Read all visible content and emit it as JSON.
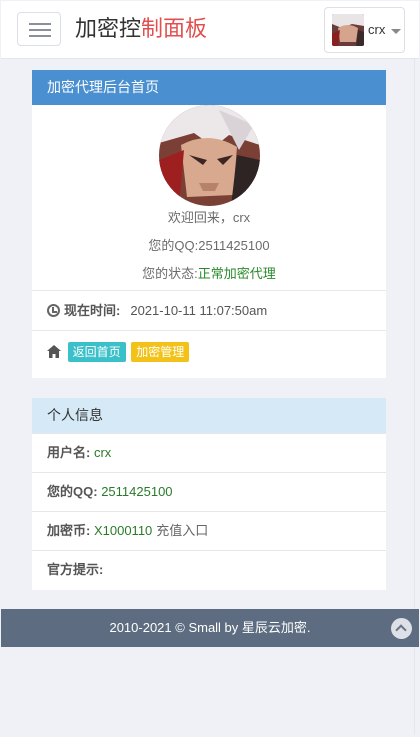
{
  "header": {
    "brand_main": "加密控",
    "brand_accent": "制面板",
    "user_name": "crx"
  },
  "panel_home": {
    "title": "加密代理后台首页",
    "welcome": "欢迎回来，crx",
    "qq_line": "您的QQ:2511425100",
    "status_label": "您的状态:",
    "status_value": "正常加密代理",
    "time_label": "现在时间:",
    "time_value": "2021-10-11 11:07:50am",
    "btn_home": "返回首页",
    "btn_manage": "加密管理"
  },
  "panel_info": {
    "title": "个人信息",
    "username_label": "用户名:",
    "username_value": "crx",
    "qq_label": "您的QQ:",
    "qq_value": "2511425100",
    "coin_label": "加密币:",
    "coin_value": "X1000110",
    "recharge_link": "充值入口",
    "tip_label": "官方提示:"
  },
  "footer": {
    "text": "2010-2021 © Small by 星辰云加密."
  },
  "icons": {
    "menu": "hamburger-icon",
    "clock": "clock-icon",
    "home": "home-icon",
    "scroll_top": "chevron-up-icon"
  },
  "colors": {
    "brand_accent": "#e24f4f",
    "panel_primary": "#4a8fd0",
    "panel_info": "#d5eaf6",
    "tag_cyan": "#39c0c8",
    "tag_yellow": "#f3c219",
    "green_text": "#2a8a2a",
    "footer": "#5d6c80"
  }
}
